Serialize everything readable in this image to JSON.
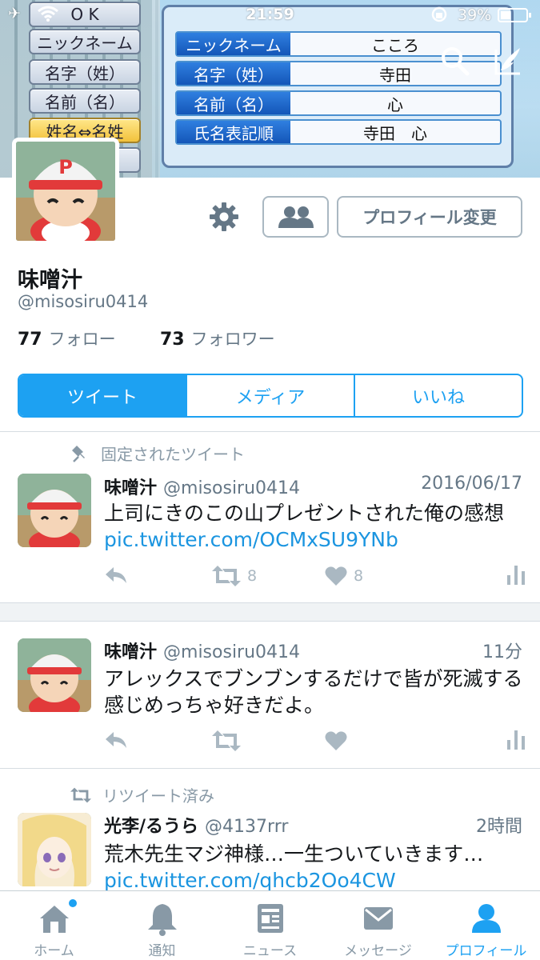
{
  "status_bar": {
    "time": "21:59",
    "battery": "39%"
  },
  "banner": {
    "menu": [
      "O K",
      "ニックネーム",
      "名字（姓）",
      "名前（名）",
      "姓名⇔名姓",
      "レ"
    ],
    "rows": [
      {
        "label": "ニックネーム",
        "value": "こころ"
      },
      {
        "label": "名字（姓）",
        "value": "寺田"
      },
      {
        "label": "名前（名）",
        "value": "心"
      },
      {
        "label": "氏名表記順",
        "value": "寺田　心"
      }
    ]
  },
  "profile": {
    "name": "味噌汁",
    "handle": "@misosiru0414",
    "following_count": "77",
    "following_label": "フォロー",
    "followers_count": "73",
    "followers_label": "フォロワー",
    "edit_button": "プロフィール変更"
  },
  "segments": {
    "tweets": "ツイート",
    "media": "メディア",
    "likes": "いいね"
  },
  "tweets": [
    {
      "context": "固定されたツイート",
      "name": "味噌汁",
      "handle": "@misosiru0414",
      "time": "2016/06/17",
      "text": "上司にきのこの山プレゼントされた俺の感想 ",
      "link": "pic.twitter.com/OCMxSU9YNb",
      "retweets": "8",
      "likes": "8"
    },
    {
      "name": "味噌汁",
      "handle": "@misosiru0414",
      "time": "11分",
      "text": "アレックスでブンブンするだけで皆が死滅する感じめっちゃ好きだよ。"
    },
    {
      "context": "リツイート済み",
      "name": "光李/るうら",
      "handle": "@4137rrr",
      "time": "2時間",
      "text": "荒木先生マジ神様…一生ついていきます…",
      "link": "pic.twitter.com/qhcb2Oo4CW"
    }
  ],
  "tabbar": {
    "home": "ホーム",
    "notifications": "通知",
    "news": "ニュース",
    "messages": "メッセージ",
    "profile": "プロフィール"
  },
  "colors": {
    "accent": "#1da1f2",
    "muted": "#8899a6"
  }
}
